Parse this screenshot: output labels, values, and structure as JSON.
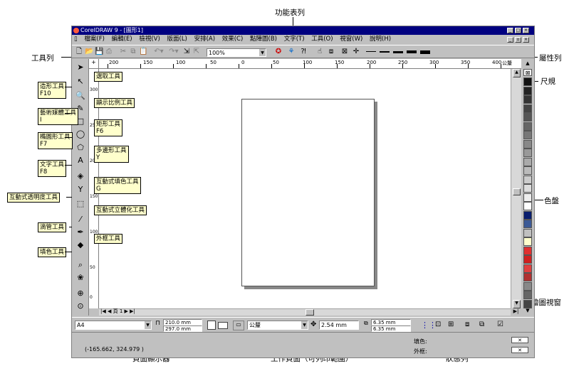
{
  "annotations": {
    "menu_bar": "功能表列",
    "toolbar": "工具列",
    "property_bar": "屬性列",
    "ruler": "尺規",
    "palette": "色盤",
    "drawing_view": "繪圖視窗",
    "page_indicator": "頁面顯示器",
    "work_page": "工作頁面（可列印範圍）",
    "status_bar": "狀態列"
  },
  "window": {
    "title": "CorelDRAW 9 - [圖形1]",
    "menus": [
      "檔案(F)",
      "編輯(E)",
      "檢視(V)",
      "版面(L)",
      "安排(A)",
      "效果(C)",
      "點陣圖(B)",
      "文字(T)",
      "工具(O)",
      "視窗(W)",
      "說明(H)"
    ]
  },
  "toolbar": {
    "zoom": "100%"
  },
  "ruler": {
    "h_labels": [
      "200",
      "150",
      "100",
      "50",
      "0",
      "50",
      "100",
      "150",
      "200",
      "250",
      "300",
      "350",
      "400"
    ],
    "unit": "公釐",
    "v_labels": [
      "300",
      "250",
      "200",
      "150",
      "100",
      "50",
      "0"
    ]
  },
  "tool_callouts": {
    "pick": "選取工具",
    "shape": "造形工具\nF10",
    "zoom": "顯示比例工具",
    "artistic": "藝術媒體工具\nI",
    "rectangle": "矩形工具\nF6",
    "ellipse": "橢圓形工具\nF7",
    "polygon": "多邊形工具\nY",
    "text": "文字工具\nF8",
    "interactive_fill": "互動式填色工具\nG",
    "transparency": "互動式透明度工具",
    "extrude": "互動式立體化工具",
    "eyedropper": "滴管工具",
    "outline": "外框工具",
    "fill": "填色工具"
  },
  "page_tabs": "頁 1",
  "property_bar": {
    "paper": "A4",
    "width": "210.0 mm",
    "height": "297.0 mm",
    "units": "公釐",
    "nudge": "2.54 mm",
    "dup_x": "6.35 mm",
    "dup_y": "6.35 mm"
  },
  "status": {
    "coords": "(-165.662, 324.979 )",
    "fill_label": "填色:",
    "outline_label": "外框:"
  },
  "palette_colors": [
    "#111111",
    "#222222",
    "#333333",
    "#444444",
    "#555555",
    "#666666",
    "#777777",
    "#888888",
    "#999999",
    "#aaaaaa",
    "#bbbbbb",
    "#cccccc",
    "#dddddd",
    "#eeeeee",
    "#ffffff",
    "#0a1e6e",
    "#3c5a96",
    "#c0c0c0",
    "#ffffcc",
    "#e03030",
    "#d02020",
    "#e04040",
    "#b03030",
    "#888888",
    "#666666",
    "#444444"
  ]
}
